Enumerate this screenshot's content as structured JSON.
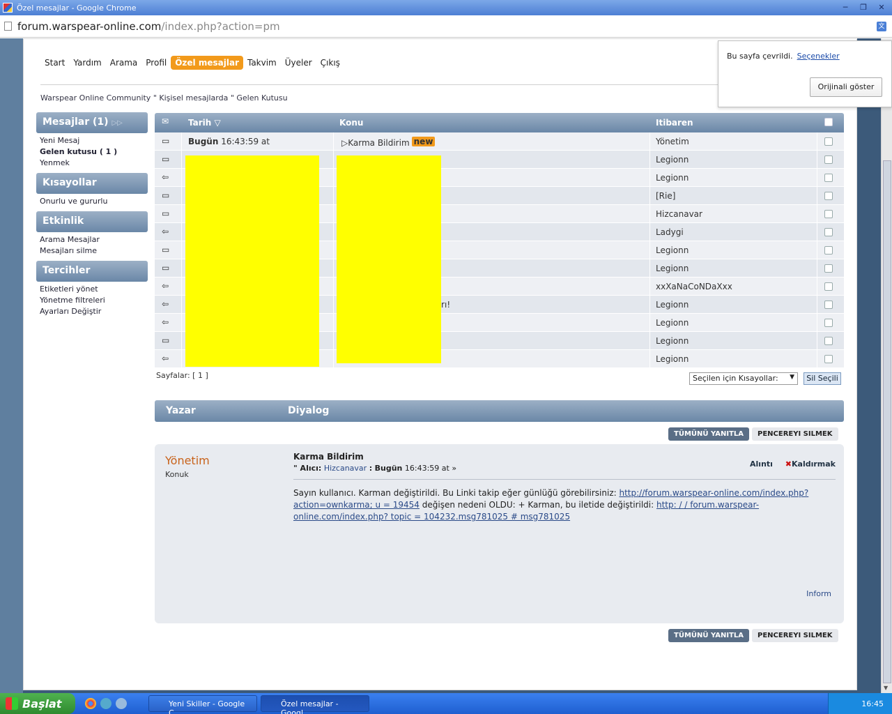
{
  "window": {
    "title": "Özel mesajlar - Google Chrome"
  },
  "address": {
    "host": "forum.warspear-online.com",
    "path": "/index.php?action=pm"
  },
  "translate_popup": {
    "message": "Bu sayfa çevrildi.",
    "options": "Seçenekler",
    "show_original": "Orijinali göster"
  },
  "menu": [
    "Start",
    "Yardım",
    "Arama",
    "Profil",
    "Özel mesajlar",
    "Takvim",
    "Üyeler",
    "Çıkış"
  ],
  "breadcrumb": "Warspear Online Community \" Kişisel mesajlarda \" Gelen Kutusu",
  "sidebar": {
    "messages": {
      "title": "Mesajlar (1)",
      "items": [
        "Yeni Mesaj",
        "Gelen kutusu ( 1 )",
        "Yenmek"
      ]
    },
    "shortcuts": {
      "title": "Kısayollar",
      "items": [
        "Onurlu ve gururlu"
      ]
    },
    "activity": {
      "title": "Etkinlik",
      "items": [
        "Arama Mesajlar",
        "Mesajları silme"
      ]
    },
    "prefs": {
      "title": "Tercihler",
      "items": [
        "Etiketleri yönet",
        "Yönetme filtreleri",
        "Ayarları Değiştir"
      ]
    }
  },
  "table": {
    "headers": {
      "date": "Tarih",
      "subject": "Konu",
      "from": "Itibaren"
    },
    "rows": [
      {
        "date_bold": "Bugün",
        "date": " 16:43:59 at",
        "subject": "Karma Bildirim",
        "new": "new",
        "from": "Yönetim"
      },
      {
        "date_bold": "",
        "date": "",
        "subject": "",
        "new": "",
        "from": "Legionn"
      },
      {
        "date_bold": "",
        "date": "",
        "subject": "",
        "new": "",
        "from": "Legionn"
      },
      {
        "date_bold": "",
        "date": "",
        "subject": "",
        "new": "",
        "from": "[Rie]"
      },
      {
        "date_bold": "",
        "date": "",
        "subject": "",
        "new": "",
        "from": "Hizcanavar"
      },
      {
        "date_bold": "",
        "date": "",
        "subject": "",
        "new": "",
        "from": "Ladygi"
      },
      {
        "date_bold": "",
        "date": "",
        "subject": "",
        "new": "",
        "from": "Legionn"
      },
      {
        "date_bold": "",
        "date": "",
        "subject": "",
        "new": "",
        "from": "Legionn"
      },
      {
        "date_bold": "",
        "date": "",
        "subject": "",
        "new": "",
        "from": "xxXaNaCoNDaXxx"
      },
      {
        "date_bold": "",
        "date": "",
        "subject": "ınıcısı Yarışması Sonuçları!",
        "new": "",
        "from": "Legionn"
      },
      {
        "date_bold": "",
        "date": "",
        "subject": "",
        "new": "",
        "from": "Legionn"
      },
      {
        "date_bold": "",
        "date": "",
        "subject": "",
        "new": "",
        "from": "Legionn"
      },
      {
        "date_bold": "",
        "date": "",
        "subject": "",
        "new": "",
        "from": "Legionn"
      }
    ]
  },
  "pages": "Sayfalar: [ 1 ]",
  "quick_select": "Seçilen için Kısayollar:",
  "delete_selected": "Sil Seçili",
  "dialog_header": {
    "author": "Yazar",
    "dialog": "Diyalog"
  },
  "buttons": {
    "reply_all": "TÜMÜNÜ YANITLA",
    "delete_window": "PENCEREYI SILMEK"
  },
  "post": {
    "author": "Yönetim",
    "role": "Konuk",
    "subject": "Karma Bildirim",
    "meta_prefix": "\" Alıcı:",
    "recipient": "Hizcanavar",
    "meta_sep": ":",
    "when_bold": "Bugün",
    "when": "16:43:59 at »",
    "quote": "Alıntı",
    "remove": "Kaldırmak",
    "body_1": "Sayın kullanıcı. Karman değiştirildi. Bu Linki takip eğer günlüğü görebilirsiniz: ",
    "link_1": "http://forum.warspear-online.com/index.php?action=ownkarma; u = 19454",
    "body_2": " değişen nedeni OLDU: + Karman, bu iletide değiştirildi: ",
    "link_2": "http: / / forum.warspear-online.com/index.php? topic = 104232.msg781025 # msg781025",
    "inform": "Inform"
  },
  "taskbar": {
    "start": "Başlat",
    "tasks": [
      "Yeni Skiller - Google C...",
      "Özel mesajlar - Googl..."
    ],
    "time": "16:45"
  }
}
